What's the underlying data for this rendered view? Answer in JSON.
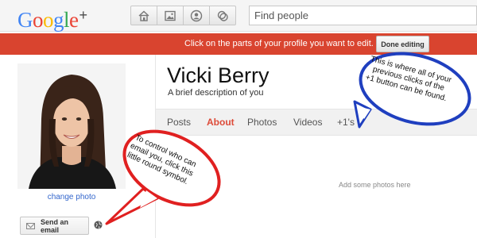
{
  "header": {
    "logo_letters": [
      "G",
      "o",
      "o",
      "g",
      "l",
      "e"
    ],
    "logo_plus": "+",
    "nav_icons": [
      "home-icon",
      "photos-icon",
      "profile-icon",
      "circles-icon"
    ],
    "search_placeholder": "Find people"
  },
  "banner": {
    "text": "Click on the parts of your profile you want to edit.",
    "done_button": "Done editing",
    "color": "#d9442f"
  },
  "sidebar": {
    "change_photo": "change photo",
    "send_email": "Send an email",
    "visibility_icon": "globe-icon"
  },
  "profile": {
    "name": "Vicki Berry",
    "description": "A brief description of you",
    "tabs": [
      {
        "label": "Posts",
        "active": false
      },
      {
        "label": "About",
        "active": true
      },
      {
        "label": "Photos",
        "active": false
      },
      {
        "label": "Videos",
        "active": false
      },
      {
        "label": "+1's",
        "active": false
      }
    ],
    "empty_photos": "Add some photos here",
    "accent_color": "#dd4b39"
  },
  "callouts": {
    "blue": {
      "lines": [
        "This is where all of your",
        "previous clicks of the",
        "+1 button can be found."
      ],
      "border_color": "#1f3fbf"
    },
    "red": {
      "lines": [
        "To control who can",
        "email you, click this",
        "little round symbol."
      ],
      "border_color": "#e02020"
    }
  }
}
